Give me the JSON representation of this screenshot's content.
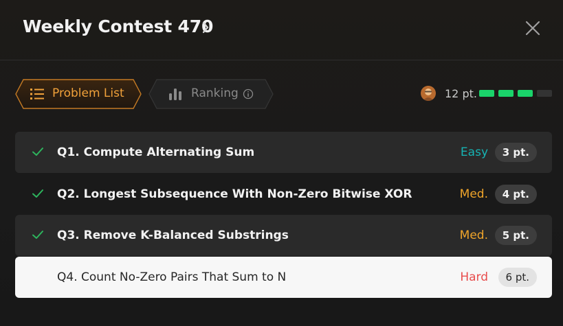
{
  "header": {
    "title": "Weekly Contest 470"
  },
  "tabs": [
    {
      "label": "Problem List",
      "active": true
    },
    {
      "label": "Ranking",
      "active": false
    }
  ],
  "score": {
    "text": "12 pt.",
    "progress_segments_filled": 3,
    "progress_segments_total": 4
  },
  "problems": [
    {
      "title": "Q1. Compute Alternating Sum",
      "difficulty": "Easy",
      "points": "3 pt.",
      "solved": true
    },
    {
      "title": "Q2. Longest Subsequence With Non-Zero Bitwise XOR",
      "difficulty": "Med.",
      "points": "4 pt.",
      "solved": true
    },
    {
      "title": "Q3. Remove K-Balanced Substrings",
      "difficulty": "Med.",
      "points": "5 pt.",
      "solved": true
    },
    {
      "title": "Q4. Count No-Zero Pairs That Sum to N",
      "difficulty": "Hard",
      "points": "6 pt.",
      "solved": false
    }
  ],
  "colors": {
    "accent": "#f0a13a",
    "easy": "#16b4b4",
    "medium": "#f0a52a",
    "hard": "#e84c4c",
    "check": "#2db55d",
    "progress": "#1ad36a"
  }
}
